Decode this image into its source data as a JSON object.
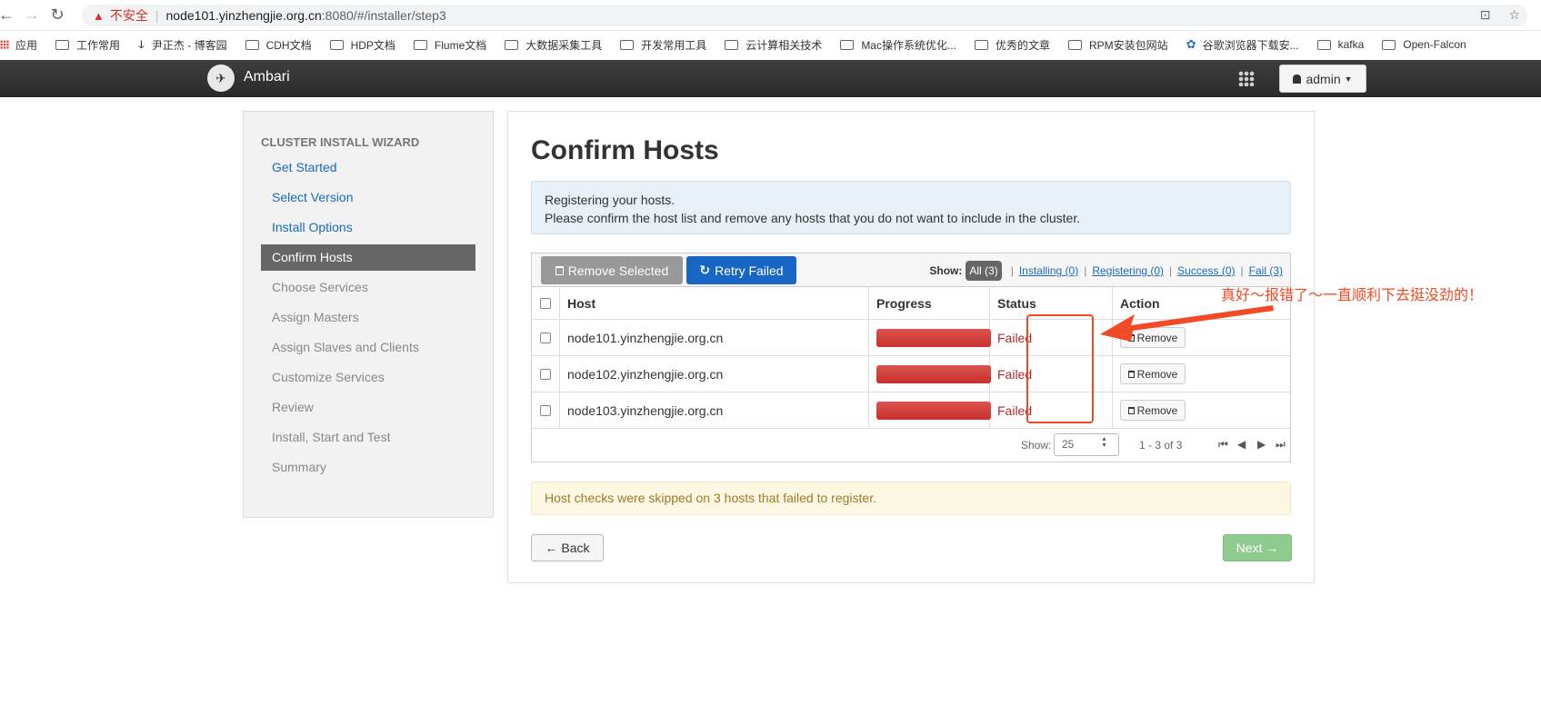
{
  "browser": {
    "insecure_label": "不安全",
    "url_host": "node101.yinzhengjie.org.cn",
    "url_rest": ":8080/#/installer/step3"
  },
  "bookmarks": [
    {
      "label": "应用",
      "icon": "apps-icon"
    },
    {
      "label": "工作常用",
      "icon": "folder-icon"
    },
    {
      "label": "尹正杰 - 博客园",
      "icon": "site-icon"
    },
    {
      "label": "CDH文档",
      "icon": "folder-icon"
    },
    {
      "label": "HDP文档",
      "icon": "folder-icon"
    },
    {
      "label": "Flume文档",
      "icon": "folder-icon"
    },
    {
      "label": "大数据采集工具",
      "icon": "folder-icon"
    },
    {
      "label": "开发常用工具",
      "icon": "folder-icon"
    },
    {
      "label": "云计算相关技术",
      "icon": "folder-icon"
    },
    {
      "label": "Mac操作系统优化...",
      "icon": "folder-icon"
    },
    {
      "label": "优秀的文章",
      "icon": "folder-icon"
    },
    {
      "label": "RPM安装包网站",
      "icon": "folder-icon"
    },
    {
      "label": "谷歌浏览器下载安...",
      "icon": "paw-icon"
    },
    {
      "label": "kafka",
      "icon": "folder-icon"
    },
    {
      "label": "Open-Falcon",
      "icon": "folder-icon"
    }
  ],
  "navbar": {
    "brand": "Ambari",
    "user": "admin"
  },
  "sidebar": {
    "title": "CLUSTER INSTALL WIZARD",
    "steps": [
      {
        "label": "Get Started",
        "state": "link"
      },
      {
        "label": "Select Version",
        "state": "link"
      },
      {
        "label": "Install Options",
        "state": "link"
      },
      {
        "label": "Confirm Hosts",
        "state": "active"
      },
      {
        "label": "Choose Services",
        "state": "disabled"
      },
      {
        "label": "Assign Masters",
        "state": "disabled"
      },
      {
        "label": "Assign Slaves and Clients",
        "state": "disabled"
      },
      {
        "label": "Customize Services",
        "state": "disabled"
      },
      {
        "label": "Review",
        "state": "disabled"
      },
      {
        "label": "Install, Start and Test",
        "state": "disabled"
      },
      {
        "label": "Summary",
        "state": "disabled"
      }
    ]
  },
  "main": {
    "title": "Confirm Hosts",
    "info_line1": "Registering your hosts.",
    "info_line2": "Please confirm the host list and remove any hosts that you do not want to include in the cluster.",
    "remove_selected": "Remove Selected",
    "retry_failed": "Retry Failed",
    "filter": {
      "label": "Show:",
      "all": "All (3)",
      "installing": "Installing (0)",
      "registering": "Registering (0)",
      "success": "Success (0)",
      "fail": "Fail (3)"
    },
    "columns": [
      "Host",
      "Progress",
      "Status",
      "Action"
    ],
    "rows": [
      {
        "host": "node101.yinzhengjie.org.cn",
        "progress": 1.0,
        "status": "Failed",
        "action": "Remove"
      },
      {
        "host": "node102.yinzhengjie.org.cn",
        "progress": 1.0,
        "status": "Failed",
        "action": "Remove"
      },
      {
        "host": "node103.yinzhengjie.org.cn",
        "progress": 1.0,
        "status": "Failed",
        "action": "Remove"
      }
    ],
    "pager": {
      "show_label": "Show:",
      "page_size": "25",
      "range": "1 - 3 of 3"
    },
    "warning": "Host checks were skipped on 3 hosts that failed to register.",
    "back": "← Back",
    "next": "Next →"
  },
  "annotation": {
    "text": "真好～报错了～一直顺利下去挺没劲的！",
    "color": "#f14a24"
  }
}
